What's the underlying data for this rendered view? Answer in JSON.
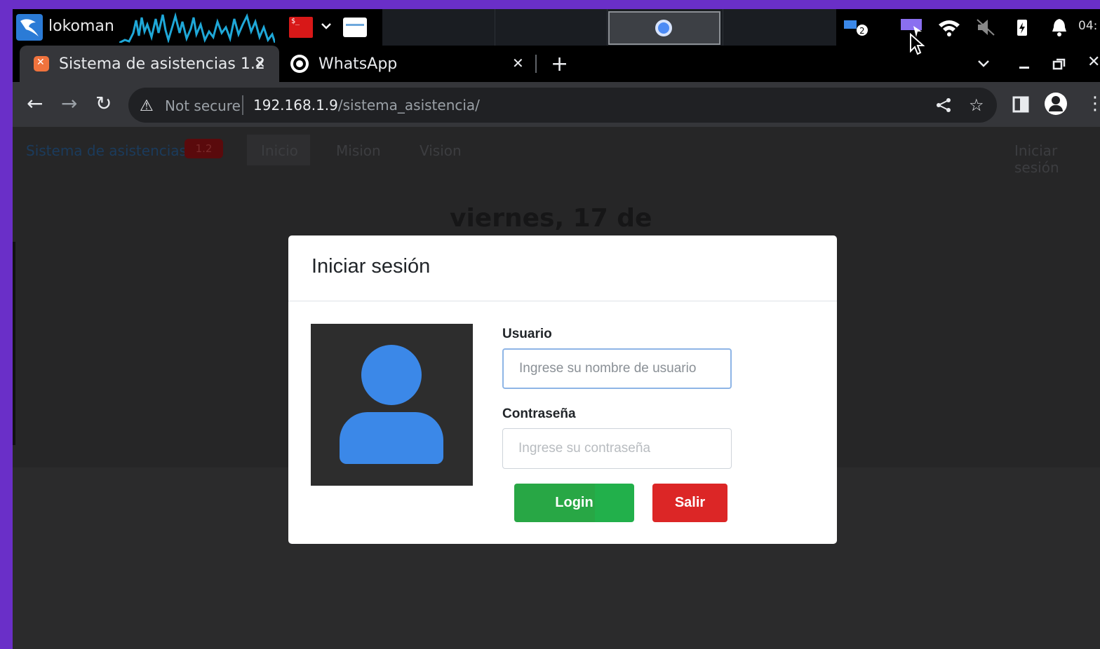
{
  "taskbar": {
    "user_label": "lokoman",
    "terminal_glyph": "$_",
    "clock_text": "04:",
    "notification_count": "2"
  },
  "browser": {
    "tabs": [
      {
        "title": "Sistema de asistencias 1.2",
        "active": true
      },
      {
        "title": "WhatsApp",
        "active": false
      }
    ],
    "security_label": "Not secure",
    "url_host": "192.168.1.9",
    "url_path": "/sistema_asistencia/"
  },
  "site": {
    "brand": "Sistema de asistencias",
    "version_badge": "1.2",
    "nav_links": [
      "Inicio",
      "Mision",
      "Vision"
    ],
    "login_link": "Iniciar sesión",
    "date_heading": "viernes, 17 de"
  },
  "modal": {
    "title": "Iniciar sesión",
    "username_label": "Usuario",
    "username_placeholder": "Ingrese su nombre de usuario",
    "password_label": "Contraseña",
    "password_placeholder": "Ingrese su contraseña",
    "login_button": "Login",
    "exit_button": "Salir"
  },
  "colors": {
    "desktop_bg": "#6a2fc8",
    "login_green": "#28a745",
    "exit_red": "#dc2626",
    "avatar_blue": "#3b88e8"
  }
}
